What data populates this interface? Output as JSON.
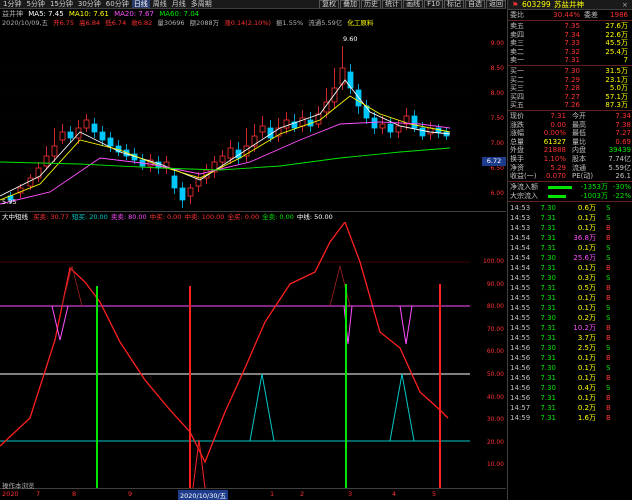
{
  "toolbar": {
    "left": [
      "1分钟",
      "5分钟",
      "15分钟",
      "30分钟",
      "60分钟",
      "日线",
      "周线",
      "月线",
      "多周期"
    ],
    "active": "日线",
    "right": [
      "复权",
      "叠加",
      "历史",
      "统计",
      "画线",
      "F10",
      "标记",
      "自选",
      "返回"
    ]
  },
  "info1": {
    "label": "益井神",
    "ma5": "MA5: 7.45",
    "ma10": "MA10: 7.61",
    "ma20": "MA20: 7.67",
    "ma60": "MA60: 7.04"
  },
  "info2": {
    "date": "2020/10/09,五",
    "open": "开6.75",
    "high": "高6.84",
    "low": "低6.74",
    "close": "收6.82",
    "vol": "量30696",
    "amt": "额2088万",
    "chg": "涨0.14(2.10%)",
    "amp": "振1.55%",
    "turn": "流通5.59亿",
    "sector": "化工原料"
  },
  "price_axis": [
    "9.00",
    "8.50",
    "8.00",
    "7.50",
    "7.00",
    "6.50",
    "6.00"
  ],
  "current_price_tag": "6.72",
  "chart_labels": {
    "high": "9.60",
    "low": "5.95"
  },
  "indicator": {
    "name": "大中短线",
    "items": [
      {
        "label": "买卖: 30.77",
        "color": "#ff3232"
      },
      {
        "label": "短买: 20.00",
        "color": "#00c8c8"
      },
      {
        "label": "卖卖: 80.00",
        "color": "#ff50ff"
      },
      {
        "label": "中买: 0.00",
        "color": "#ff3232"
      },
      {
        "label": "中卖: 100.00",
        "color": "#ff3232"
      },
      {
        "label": "全买: 0.00",
        "color": "#ff3232"
      },
      {
        "label": "全卖: 0.00",
        "color": "#00e600"
      },
      {
        "label": "中线: 50.00",
        "color": "#ffffff"
      }
    ],
    "axis": [
      "100.00",
      "90.00",
      "80.00",
      "70.00",
      "60.00",
      "50.00",
      "40.00",
      "30.00",
      "20.00",
      "10.00"
    ]
  },
  "dates": [
    "2020",
    "7",
    "8",
    "9",
    "2020/10/30/五",
    "1",
    "2",
    "3",
    "4",
    "5"
  ],
  "bottom_left": "操作本浏览",
  "stock": {
    "code": "603299",
    "name": "苏盐井神"
  },
  "summary": [
    {
      "c1": "委比",
      "c2": "30.44%",
      "c3l": "委差",
      "c3": "1986",
      "c2color": "#ff3232",
      "c3color": "#ff3232"
    }
  ],
  "asks": [
    {
      "label": "卖五",
      "price": "7.35",
      "vol": "27.6万"
    },
    {
      "label": "卖四",
      "price": "7.34",
      "vol": "22.6万"
    },
    {
      "label": "卖三",
      "price": "7.33",
      "vol": "45.5万"
    },
    {
      "label": "卖二",
      "price": "7.32",
      "vol": "25.4万"
    },
    {
      "label": "卖一",
      "price": "7.31",
      "vol": "7"
    }
  ],
  "bids": [
    {
      "label": "买一",
      "price": "7.30",
      "vol": "31.5万"
    },
    {
      "label": "买二",
      "price": "7.29",
      "vol": "23.1万"
    },
    {
      "label": "买三",
      "price": "7.28",
      "vol": "5.0万"
    },
    {
      "label": "买四",
      "price": "7.27",
      "vol": "57.1万"
    },
    {
      "label": "买五",
      "price": "7.26",
      "vol": "87.3万"
    }
  ],
  "quote": [
    {
      "a": "现价",
      "av": "7.31",
      "b": "今开",
      "bv": "7.34"
    },
    {
      "a": "涨跌",
      "av": "0.00",
      "b": "最高",
      "bv": "7.38"
    },
    {
      "a": "涨幅",
      "av": "0.00%",
      "b": "最低",
      "bv": "7.27"
    },
    {
      "a": "总量",
      "av": "61327",
      "b": "量比",
      "bv": "0.69"
    },
    {
      "a": "外盘",
      "av": "21888",
      "b": "内盘",
      "bv": "39439"
    },
    {
      "a": "换手",
      "av": "1.10%",
      "b": "股本",
      "bv": "7.74亿"
    },
    {
      "a": "净资",
      "av": "5.29",
      "b": "流通",
      "bv": "5.59亿"
    },
    {
      "a": "收益(一)",
      "av": "0.070",
      "b": "PE(动)",
      "bv": "26.1"
    }
  ],
  "flows": [
    {
      "label": "净流入额",
      "value": "-1353万",
      "pct": "-30%"
    },
    {
      "label": "大宗流入",
      "value": "-1003万",
      "pct": "-22%"
    }
  ],
  "ticks": [
    {
      "t": "14:53",
      "p": "7.30",
      "v": "0.6万",
      "d": "S",
      "dc": "#00e600"
    },
    {
      "t": "14:53",
      "p": "7.31",
      "v": "0.1万",
      "d": "S",
      "dc": "#00e600"
    },
    {
      "t": "14:53",
      "p": "7.31",
      "v": "0.1万",
      "d": "B",
      "dc": "#ff3232"
    },
    {
      "t": "14:54",
      "p": "7.31",
      "v": "36.8万",
      "d": "B",
      "dc": "#ff3232"
    },
    {
      "t": "14:54",
      "p": "7.31",
      "v": "0.1万",
      "d": "S",
      "dc": "#00e600"
    },
    {
      "t": "14:54",
      "p": "7.30",
      "v": "25.6万",
      "d": "S",
      "dc": "#00e600"
    },
    {
      "t": "14:54",
      "p": "7.31",
      "v": "0.1万",
      "d": "B",
      "dc": "#ff3232"
    },
    {
      "t": "14:55",
      "p": "7.30",
      "v": "0.3万",
      "d": "S",
      "dc": "#00e600"
    },
    {
      "t": "14:55",
      "p": "7.31",
      "v": "0.5万",
      "d": "B",
      "dc": "#ff3232"
    },
    {
      "t": "14:55",
      "p": "7.31",
      "v": "0.1万",
      "d": "B",
      "dc": "#ff3232"
    },
    {
      "t": "14:55",
      "p": "7.31",
      "v": "0.1万",
      "d": "S",
      "dc": "#00e600"
    },
    {
      "t": "14:55",
      "p": "7.30",
      "v": "0.2万",
      "d": "S",
      "dc": "#00e600"
    },
    {
      "t": "14:55",
      "p": "7.31",
      "v": "10.2万",
      "d": "B",
      "dc": "#ff3232"
    },
    {
      "t": "14:55",
      "p": "7.31",
      "v": "3.7万",
      "d": "B",
      "dc": "#ff3232"
    },
    {
      "t": "14:56",
      "p": "7.30",
      "v": "2.5万",
      "d": "S",
      "dc": "#00e600"
    },
    {
      "t": "14:56",
      "p": "7.31",
      "v": "0.1万",
      "d": "B",
      "dc": "#ff3232"
    },
    {
      "t": "14:56",
      "p": "7.30",
      "v": "0.1万",
      "d": "S",
      "dc": "#00e600"
    },
    {
      "t": "14:56",
      "p": "7.31",
      "v": "0.1万",
      "d": "B",
      "dc": "#ff3232"
    },
    {
      "t": "14:56",
      "p": "7.30",
      "v": "0.4万",
      "d": "S",
      "dc": "#00e600"
    },
    {
      "t": "14:56",
      "p": "7.31",
      "v": "0.1万",
      "d": "B",
      "dc": "#ff3232"
    },
    {
      "t": "14:57",
      "p": "7.31",
      "v": "0.2万",
      "d": "B",
      "dc": "#ff3232"
    },
    {
      "t": "14:59",
      "p": "7.31",
      "v": "1.6万",
      "d": "B",
      "dc": "#ff3232"
    }
  ],
  "colors": {
    "up": "#ff3232",
    "down": "#00c8ff",
    "ma5": "#ffffff",
    "ma10": "#ffff00",
    "ma20": "#ff50ff",
    "ma60": "#00e600"
  }
}
